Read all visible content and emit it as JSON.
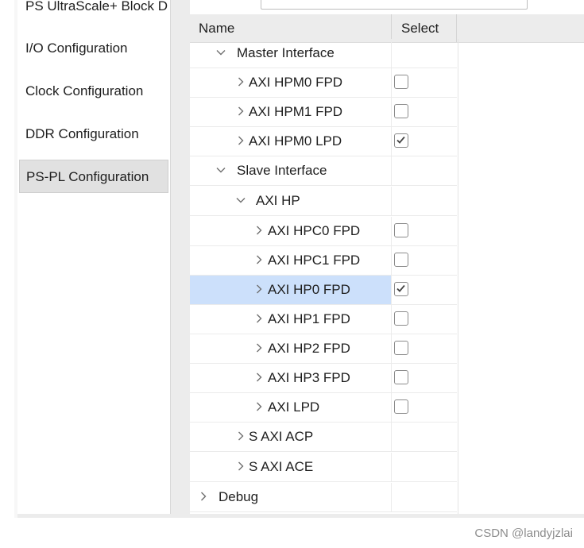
{
  "nav": {
    "items": [
      {
        "label": "PS UltraScale+ Block D",
        "selected": false
      },
      {
        "label": "I/O Configuration",
        "selected": false
      },
      {
        "label": "Clock Configuration",
        "selected": false
      },
      {
        "label": "DDR Configuration",
        "selected": false
      },
      {
        "label": "PS-PL Configuration",
        "selected": true
      }
    ]
  },
  "tree": {
    "columns": {
      "name": "Name",
      "select": "Select"
    },
    "rows": [
      {
        "label": "Master Interface",
        "expanded": true
      },
      {
        "label": "AXI HPM0 FPD",
        "expanded": false,
        "checked": false
      },
      {
        "label": "AXI HPM1 FPD",
        "expanded": false,
        "checked": false
      },
      {
        "label": "AXI HPM0 LPD",
        "expanded": false,
        "checked": true
      },
      {
        "label": "Slave Interface",
        "expanded": true
      },
      {
        "label": "AXI HP",
        "expanded": true
      },
      {
        "label": "AXI HPC0 FPD",
        "expanded": false,
        "checked": false
      },
      {
        "label": "AXI HPC1 FPD",
        "expanded": false,
        "checked": false
      },
      {
        "label": "AXI HP0 FPD",
        "expanded": false,
        "checked": true,
        "highlighted": true
      },
      {
        "label": "AXI HP1 FPD",
        "expanded": false,
        "checked": false
      },
      {
        "label": "AXI HP2 FPD",
        "expanded": false,
        "checked": false
      },
      {
        "label": "AXI HP3 FPD",
        "expanded": false,
        "checked": false
      },
      {
        "label": "AXI LPD",
        "expanded": false,
        "checked": false
      },
      {
        "label": "S AXI ACP",
        "expanded": false
      },
      {
        "label": "S AXI ACE",
        "expanded": false
      },
      {
        "label": "Debug",
        "expanded": false
      }
    ]
  },
  "watermark": "CSDN @landyjzlai",
  "colors": {
    "highlight": "#cce0fb",
    "header_bg": "#ececec"
  }
}
